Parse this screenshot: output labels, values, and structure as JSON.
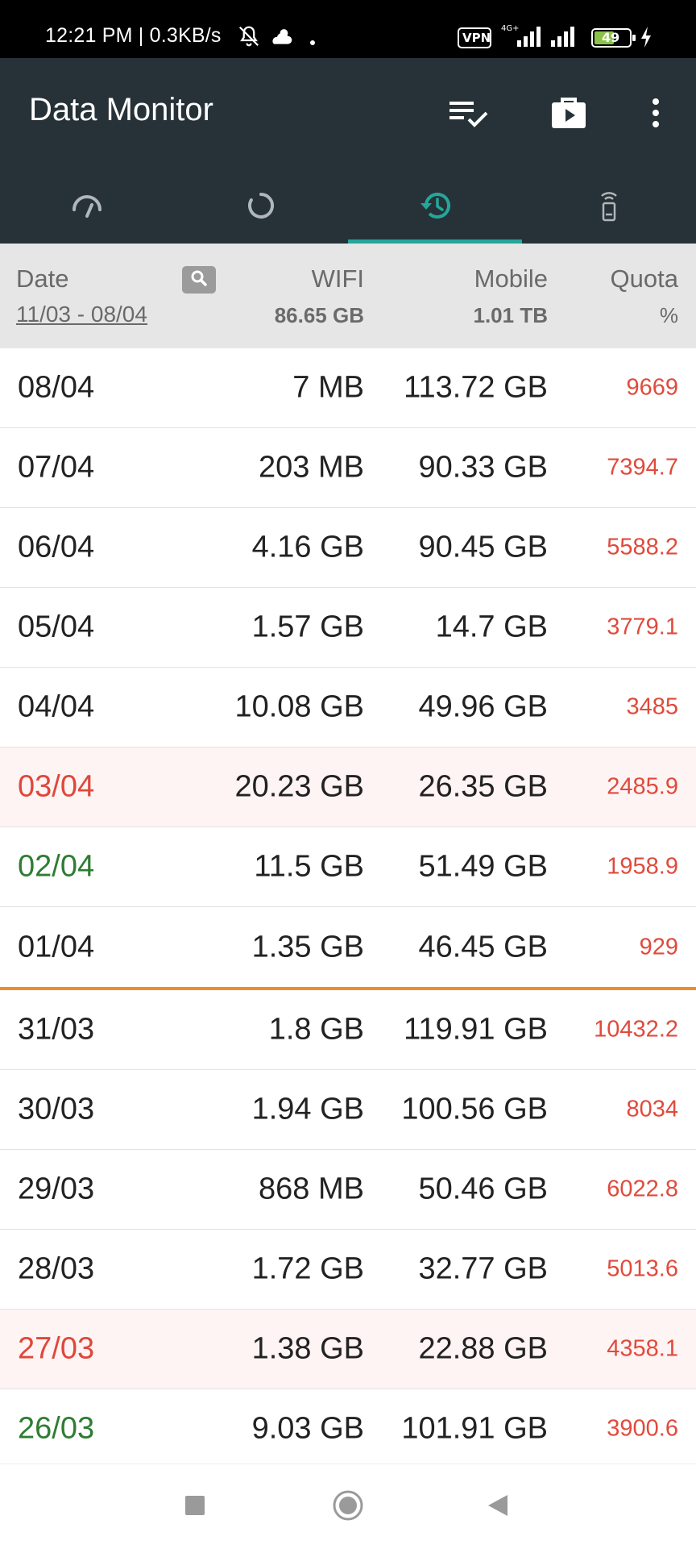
{
  "status_bar": {
    "time": "12:21 PM | 0.3KB/s",
    "vpn": "VPN",
    "network": "4G+",
    "battery": "49"
  },
  "toolbar": {
    "title": "Data Monitor",
    "icons": [
      "checklist-icon",
      "briefcase-icon",
      "more-vert-icon"
    ]
  },
  "tabs": [
    {
      "icon": "speedometer-icon",
      "active": false
    },
    {
      "icon": "circular-progress-icon",
      "active": false
    },
    {
      "icon": "history-icon",
      "active": true
    },
    {
      "icon": "router-icon",
      "active": false
    }
  ],
  "header": {
    "date_label": "Date",
    "range": "11/03 - 08/04",
    "wifi_label": "WIFI",
    "wifi_total": "86.65 GB",
    "mobile_label": "Mobile",
    "mobile_total": "1.01 TB",
    "quota_label": "Quota",
    "quota_unit": "%"
  },
  "rows": [
    {
      "date": "08/04",
      "wifi": "7 MB",
      "mobile": "113.72 GB",
      "quota": "9669",
      "style": ""
    },
    {
      "date": "07/04",
      "wifi": "203 MB",
      "mobile": "90.33 GB",
      "quota": "7394.7",
      "style": ""
    },
    {
      "date": "06/04",
      "wifi": "4.16 GB",
      "mobile": "90.45 GB",
      "quota": "5588.2",
      "style": ""
    },
    {
      "date": "05/04",
      "wifi": "1.57 GB",
      "mobile": "14.7 GB",
      "quota": "3779.1",
      "style": ""
    },
    {
      "date": "04/04",
      "wifi": "10.08 GB",
      "mobile": "49.96 GB",
      "quota": "3485",
      "style": ""
    },
    {
      "date": "03/04",
      "wifi": "20.23 GB",
      "mobile": "26.35 GB",
      "quota": "2485.9",
      "style": "red"
    },
    {
      "date": "02/04",
      "wifi": "11.5 GB",
      "mobile": "51.49 GB",
      "quota": "1958.9",
      "style": "green"
    },
    {
      "date": "01/04",
      "wifi": "1.35 GB",
      "mobile": "46.45 GB",
      "quota": "929",
      "style": "sep"
    },
    {
      "date": "31/03",
      "wifi": "1.8 GB",
      "mobile": "119.91 GB",
      "quota": "10432.2",
      "style": ""
    },
    {
      "date": "30/03",
      "wifi": "1.94 GB",
      "mobile": "100.56 GB",
      "quota": "8034",
      "style": ""
    },
    {
      "date": "29/03",
      "wifi": "868 MB",
      "mobile": "50.46 GB",
      "quota": "6022.8",
      "style": ""
    },
    {
      "date": "28/03",
      "wifi": "1.72 GB",
      "mobile": "32.77 GB",
      "quota": "5013.6",
      "style": ""
    },
    {
      "date": "27/03",
      "wifi": "1.38 GB",
      "mobile": "22.88 GB",
      "quota": "4358.1",
      "style": "red"
    },
    {
      "date": "26/03",
      "wifi": "9.03 GB",
      "mobile": "101.91 GB",
      "quota": "3900.6",
      "style": "green"
    }
  ],
  "colors": {
    "toolbar": "#263238",
    "accent": "#26a69a",
    "quota": "#e04a3c",
    "weekend_red": "#e0473a",
    "weekend_green": "#2e7d32",
    "month_separator": "#ef8c2a"
  }
}
